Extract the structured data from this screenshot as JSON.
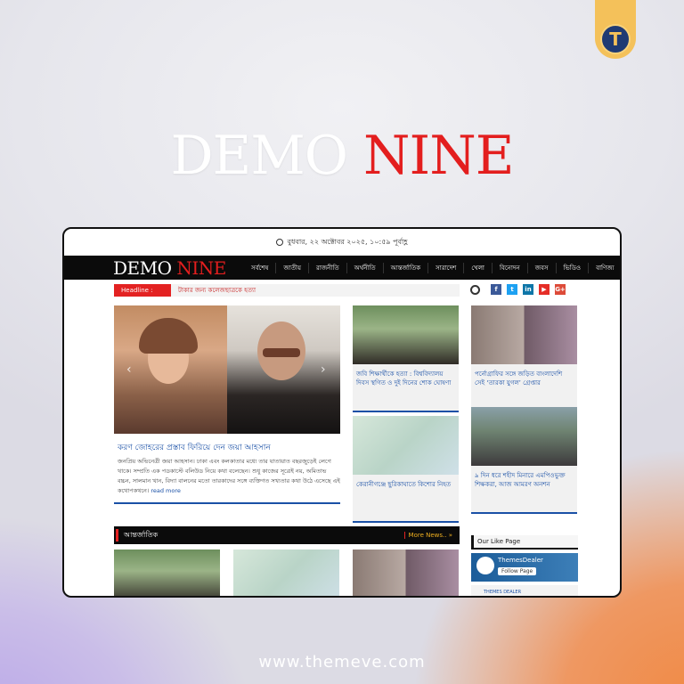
{
  "badge": {
    "letter": "T"
  },
  "hero": {
    "word1": "DEMO",
    "word2": "NINE"
  },
  "footer": {
    "url": "www.themeve.com"
  },
  "site": {
    "date": "বুধবার, ২২ অক্টোবর ২০২৫, ১০:৫৯ পূর্বাহ্ণ",
    "logo_word1": "DEMO",
    "logo_word2": "NINE",
    "menu": [
      "সর্বশেষ",
      "জাতীয়",
      "রাজনীতি",
      "অর্থনীতি",
      "আন্তর্জাতিক",
      "সারাদেশ",
      "খেলা",
      "বিনোদন",
      "জবস",
      "ভিডিও",
      "বাণিজ্য"
    ],
    "headline_label": "Headline :",
    "headline_text": "টাকার জন্য কলেজছাত্রকে হত্যা",
    "social": [
      "f",
      "t",
      "in",
      "▶",
      "G+"
    ],
    "main": {
      "title": "করণ জোহরের প্রস্তাব ফিরিয়ে দেন জয়া আহসান",
      "body": "জনপ্রিয় অভিনেত্রী জয়া আহসান। ঢাকা এবং কলকাতার মধ্যে তার যাতায়াত বছরজুড়েই লেগে থাকে। সম্প্রতি এক পডকাস্টে বলিউড নিয়ে কথা বলেছেন। শুধু কাজের সূত্রেই নয়, অমিতাভ বচ্চন, সালমান খান, বিদ্যা বালনের মতো তারকাদের সঙ্গে ব্যক্তিগত সখ্যতার কথা উঠে এসেছে এই কথোপকথনে।",
      "read_more": "read more"
    },
    "cards": [
      {
        "title": "জবি শিক্ষার্থীকে হত্যা : বিশ্ববিদ্যালয় দিবস স্থগিত ও দুই দিনের শোক ঘোষণা"
      },
      {
        "title": "কেরানীগঞ্জে ছুরিকাঘাতে কিশোর নিহত"
      },
      {
        "title": "পর্নোগ্রাফির সঙ্গে জড়িত বাংলাদেশি সেই ‘তারকা যুগল’ গ্রেপ্তার"
      },
      {
        "title": "৯ দিন ধরে শহীদ মিনারে এমপিওভুক্ত শিক্ষকরা, আজ আমরণ অনশন"
      }
    ],
    "section": {
      "title": "আন্তর্জাতিক",
      "more": "More News.. »"
    },
    "like": {
      "title": "Our Like Page",
      "page_name": "ThemesDealer",
      "follow": "Follow Page",
      "brand": "THEMES DEALER"
    }
  }
}
